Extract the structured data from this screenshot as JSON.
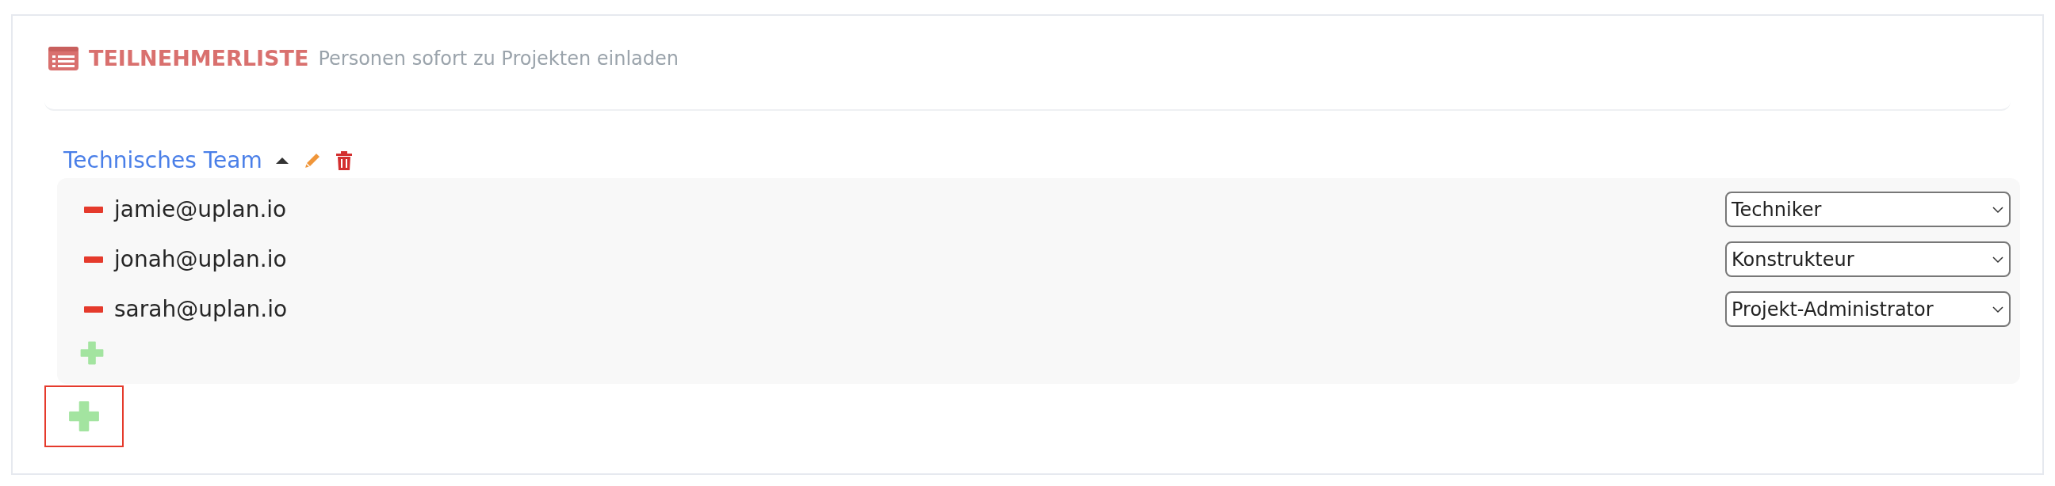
{
  "header": {
    "title": "TEILNEHMERLISTE",
    "subtitle": "Personen sofort zu Projekten einladen"
  },
  "groups": [
    {
      "name": "Technisches Team",
      "expanded": true,
      "members": [
        {
          "email": "jamie@uplan.io",
          "role": "Techniker"
        },
        {
          "email": "jonah@uplan.io",
          "role": "Konstrukteur"
        },
        {
          "email": "sarah@uplan.io",
          "role": "Projekt-Administrator"
        }
      ]
    }
  ],
  "add_group_button": {
    "highlighted": true
  }
}
